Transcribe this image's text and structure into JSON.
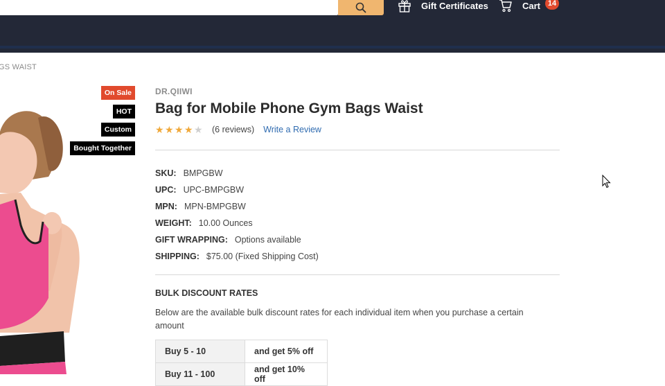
{
  "header": {
    "gift_certificates": "Gift Certificates",
    "cart_label": "Cart",
    "cart_count": "14",
    "icons": [
      "search-icon",
      "gift-icon",
      "cart-icon"
    ]
  },
  "breadcrumb": "GS WAIST",
  "badges": {
    "on_sale": "On Sale",
    "hot": "HOT",
    "custom": "Custom",
    "bought_together": "Bought Together"
  },
  "product": {
    "brand": "DR.QIIWI",
    "title": "Bag for Mobile Phone Gym Bags Waist",
    "rating": 4,
    "rating_max": 5,
    "reviews": "(6 reviews)",
    "write_review": "Write a Review"
  },
  "specs": [
    {
      "label": "SKU:",
      "value": "BMPGBW"
    },
    {
      "label": "UPC:",
      "value": "UPC-BMPGBW"
    },
    {
      "label": "MPN:",
      "value": "MPN-BMPGBW"
    },
    {
      "label": "WEIGHT:",
      "value": "10.00 Ounces"
    },
    {
      "label": "GIFT WRAPPING:",
      "value": "Options available"
    },
    {
      "label": "SHIPPING:",
      "value": "$75.00 (Fixed Shipping Cost)"
    }
  ],
  "bulk": {
    "title": "BULK DISCOUNT RATES",
    "description": "Below are the available bulk discount rates for each individual item when you purchase a certain amount",
    "rows": [
      {
        "qty": "Buy 5 - 10",
        "discount": "and get 5% off"
      },
      {
        "qty": "Buy 11 - 100",
        "discount": "and get 10% off"
      }
    ]
  },
  "colors": {
    "header_bg": "#232837",
    "search_button": "#f0b66f",
    "sale_badge": "#e14a2d",
    "star": "#f0a93b",
    "link": "#2f6bb0"
  }
}
